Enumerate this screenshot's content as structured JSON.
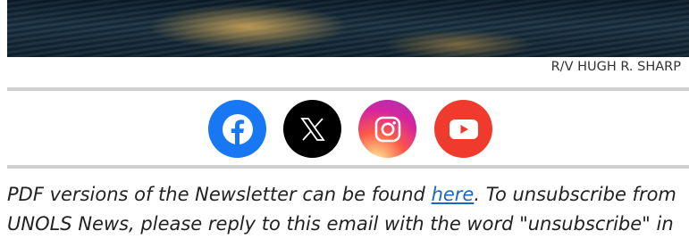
{
  "hero": {
    "image_description": ""
  },
  "caption": {
    "text": "R/V HUGH R. SHARP"
  },
  "social": {
    "items": [
      {
        "name": "facebook-icon",
        "color": "#1877f2"
      },
      {
        "name": "x-icon",
        "color": "#000000"
      },
      {
        "name": "instagram-icon",
        "color": "#d6249f"
      },
      {
        "name": "youtube-icon",
        "color": "#f03a2e"
      }
    ]
  },
  "notice": {
    "line1_before": "PDF versions of the Newsletter can be found ",
    "link_text": "here",
    "line1_after": ". To unsubscribe from",
    "line2": "UNOLS News, please reply to this email with the word \"unsubscribe\" in"
  }
}
